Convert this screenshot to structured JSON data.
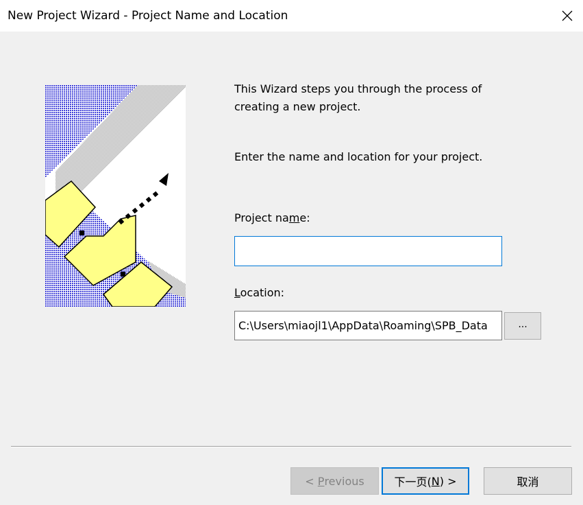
{
  "window": {
    "title": "New Project Wizard - Project Name and Location",
    "close_icon": "close-icon"
  },
  "content": {
    "intro_line1": "This Wizard steps you through the process of",
    "intro_line2": "creating a new project.",
    "instruction": "Enter the name and location for your project.",
    "project_name": {
      "label_pre": "Project na",
      "label_accel": "m",
      "label_post": "e:",
      "value": ""
    },
    "location": {
      "label_pre": "",
      "label_accel": "L",
      "label_post": "ocation:",
      "value": "C:\\Users\\miaojl1\\AppData\\Roaming\\SPB_Data"
    },
    "browse_label": "..."
  },
  "buttons": {
    "previous": {
      "prefix": "< ",
      "accel": "P",
      "rest": "revious"
    },
    "next": {
      "pre": "下一页(",
      "accel": "N",
      "post": ") >"
    },
    "cancel": "取消"
  },
  "colors": {
    "accent": "#0078d7",
    "illustration_blue": "#5252e0",
    "illustration_yellow": "#ffff88",
    "illustration_gray": "#c8c8c8"
  }
}
